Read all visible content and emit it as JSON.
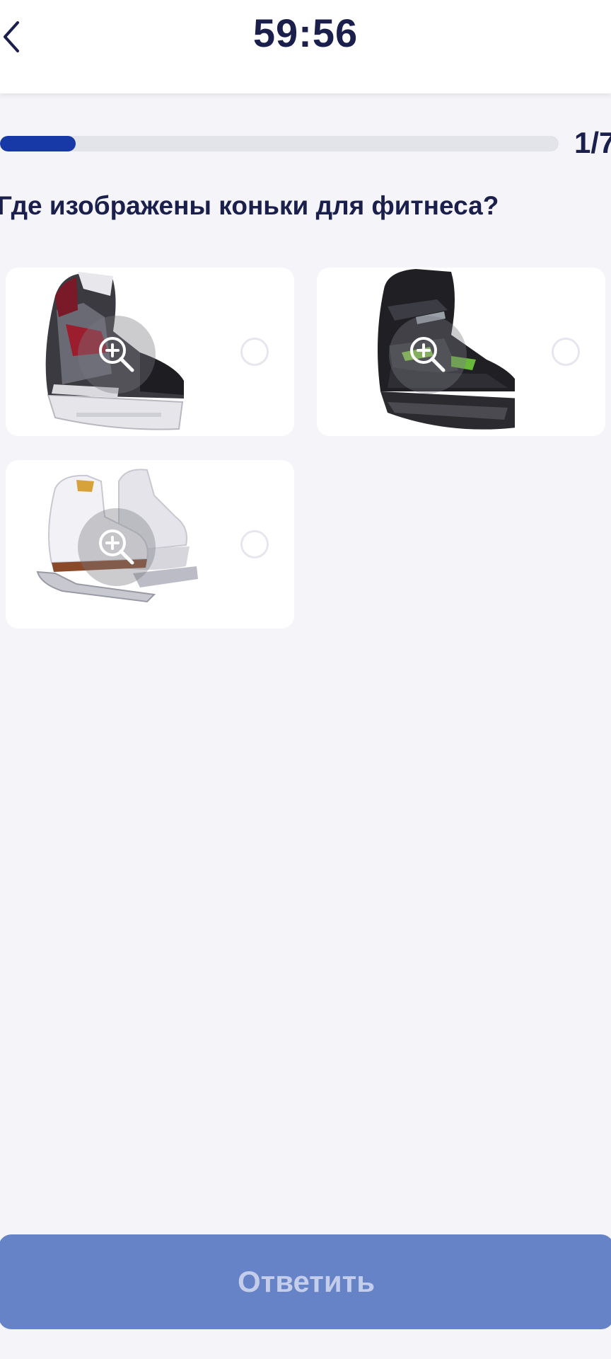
{
  "header": {
    "back_icon": "chevron-left-icon",
    "timer": "59:56"
  },
  "progress": {
    "current": 1,
    "total": 7,
    "fraction": 0.135,
    "label": "1/7",
    "color": "#1739a8"
  },
  "question": {
    "text": "Где изображены коньки для фитнеса?"
  },
  "options": [
    {
      "image": "hockey-skate-image",
      "zoom_icon": "zoom-in-icon",
      "selected": false
    },
    {
      "image": "fitness-skate-image",
      "zoom_icon": "zoom-in-icon",
      "selected": false
    },
    {
      "image": "figure-skate-image",
      "zoom_icon": "zoom-in-icon",
      "selected": false
    }
  ],
  "submit": {
    "label": "Ответить",
    "enabled": false,
    "color": "#6683c8"
  }
}
